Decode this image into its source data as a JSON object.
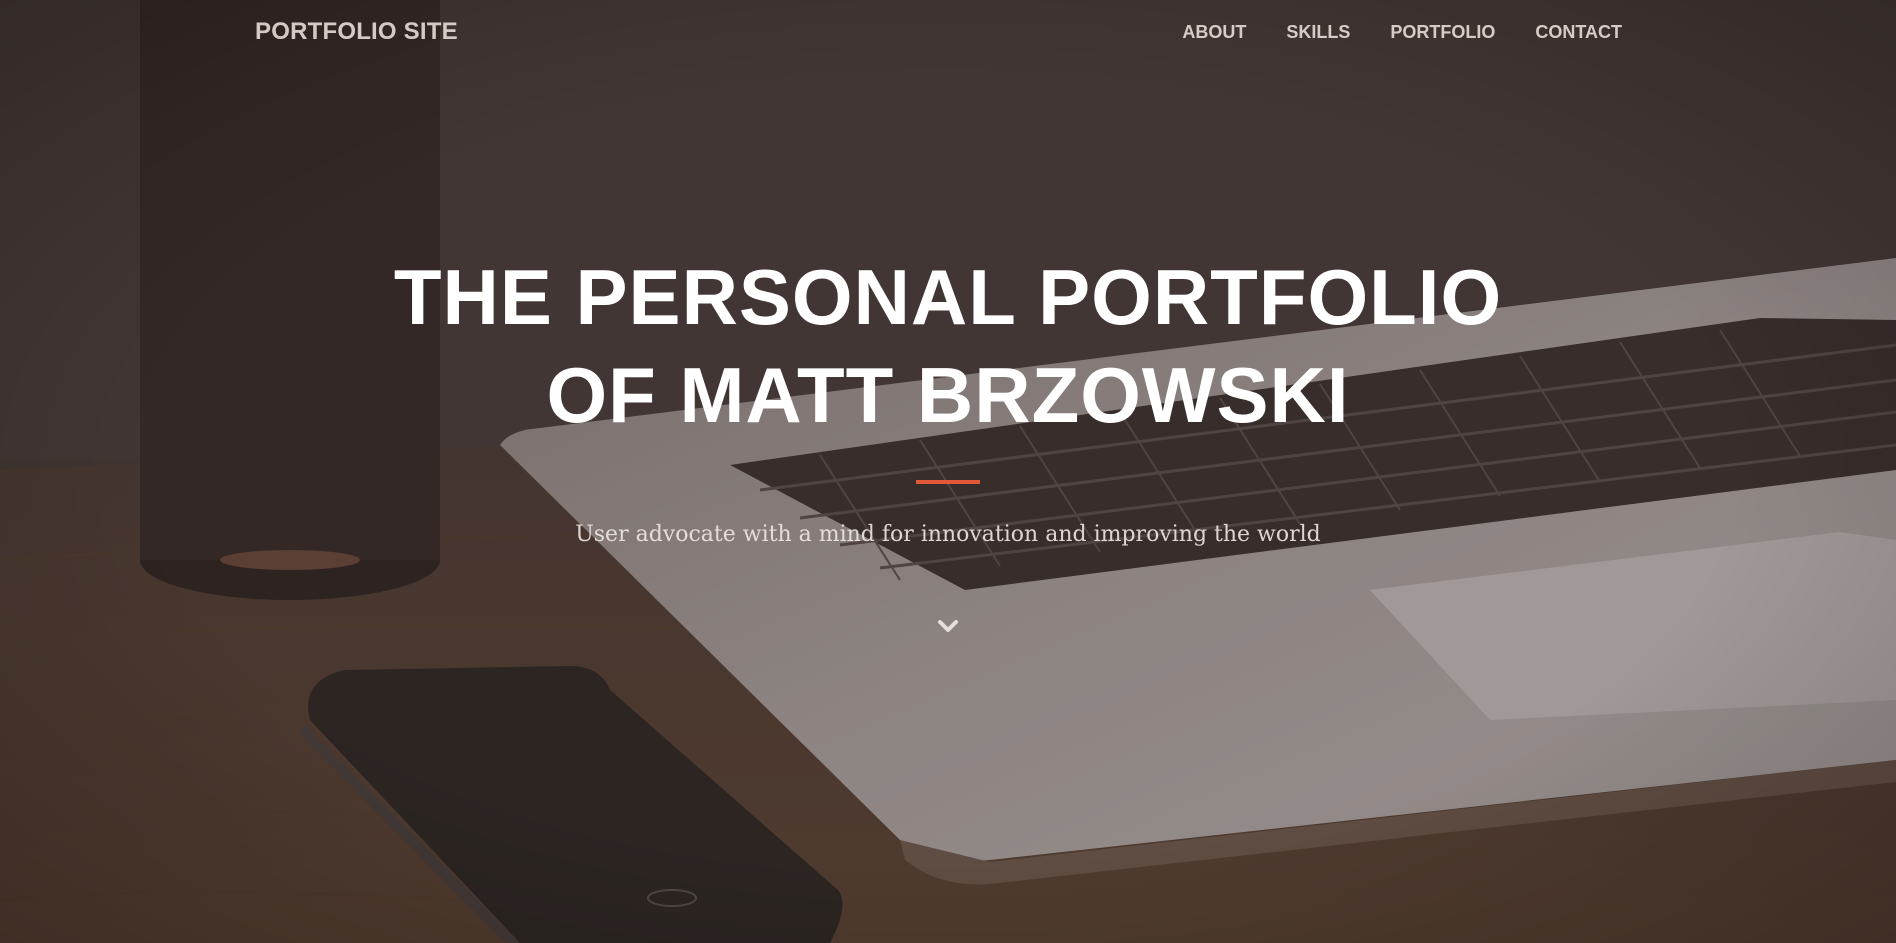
{
  "navbar": {
    "brand": "PORTFOLIO SITE",
    "links": [
      {
        "label": "ABOUT"
      },
      {
        "label": "SKILLS"
      },
      {
        "label": "PORTFOLIO"
      },
      {
        "label": "CONTACT"
      }
    ]
  },
  "hero": {
    "title_line1": "THE PERSONAL PORTFOLIO",
    "title_line2": "OF MATT BRZOWSKI",
    "tagline": "User advocate with a mind for innovation and improving the world",
    "scroll_icon": "chevron-down-icon"
  },
  "colors": {
    "accent": "#e05a3a",
    "text": "#ffffff",
    "overlay": "#3b302c"
  }
}
